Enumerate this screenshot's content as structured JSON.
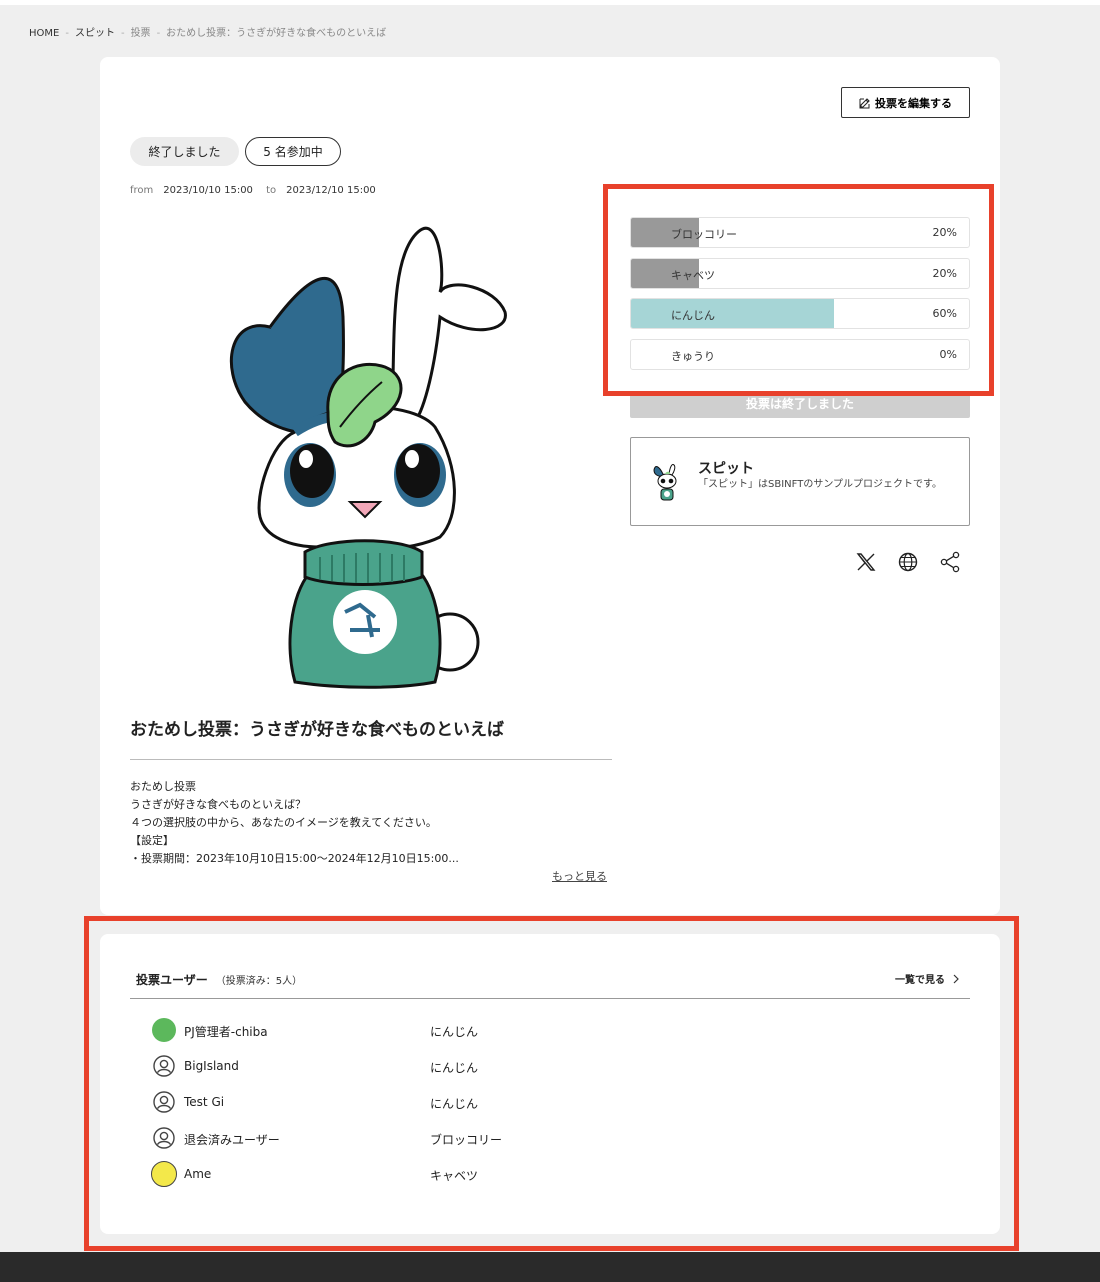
{
  "breadcrumb": {
    "home": "HOME",
    "project": "スピット",
    "section": "投票",
    "current": "おためし投票：うさぎが好きな食べものといえば"
  },
  "edit_button": {
    "label": "投票を編集する",
    "icon": "edit-icon"
  },
  "status": {
    "ended": "終了しました",
    "participants": "5 名参加中"
  },
  "period": {
    "from_label": "from",
    "from": "2023/10/10 15:00",
    "to_label": "to",
    "to": "2023/12/10 15:00"
  },
  "vote_title": "おためし投票：うさぎが好きな食べものといえば",
  "description": [
    "おためし投票",
    "うさぎが好きな食べものといえば？",
    "４つの選択肢の中から、あなたのイメージを教えてください。",
    "【設定】",
    "・投票期間：2023年10月10日15:00〜2024年12月10日15:00..."
  ],
  "more_link": "もっと見る",
  "options": [
    {
      "label": "ブロッコリー",
      "percent_text": "20%",
      "ratio": 0.2,
      "color": "#999999"
    },
    {
      "label": "キャベツ",
      "percent_text": "20%",
      "ratio": 0.2,
      "color": "#999999"
    },
    {
      "label": "にんじん",
      "percent_text": "60%",
      "ratio": 0.6,
      "color": "#a6d5d6"
    },
    {
      "label": "きゅうり",
      "percent_text": "0%",
      "ratio": 0.0,
      "color": "#999999"
    }
  ],
  "closed_button": "投票は終了しました",
  "project": {
    "name": "スピット",
    "description": "「スピット」はSBINFTのサンプルプロジェクトです。"
  },
  "share_icons": [
    "x-icon",
    "globe-icon",
    "share-icon"
  ],
  "users": {
    "title": "投票ユーザー",
    "count": "（投票済み：5人）",
    "view_all": "一覧で見る",
    "rows": [
      {
        "name": "PJ管理者-chiba",
        "choice": "にんじん",
        "avatar": "green",
        "avatar_color": "#5cb85c"
      },
      {
        "name": "BigIsland",
        "choice": "にんじん",
        "avatar": "default"
      },
      {
        "name": "Test Gi",
        "choice": "にんじん",
        "avatar": "default"
      },
      {
        "name": "退会済みユーザー",
        "choice": "ブロッコリー",
        "avatar": "default"
      },
      {
        "name": "Ame",
        "choice": "キャベツ",
        "avatar": "yellow",
        "avatar_color": "#f3e84a"
      }
    ]
  },
  "colors": {
    "highlight": "#e8412b",
    "accent_fill": "#a6d5d6",
    "bunny_blue": "#2f6a8e",
    "sweater_green": "#4aa38b"
  }
}
